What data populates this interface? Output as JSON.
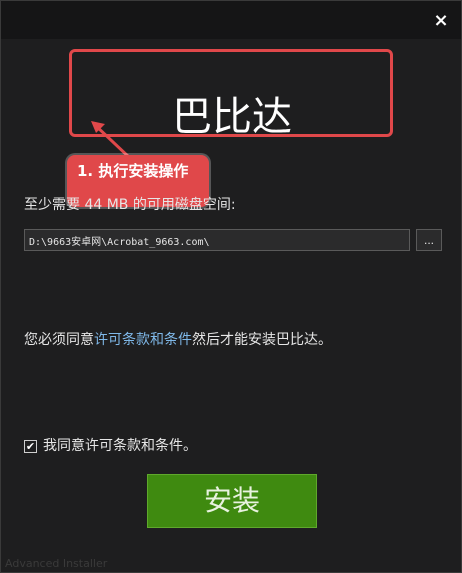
{
  "window": {
    "close_label": "×"
  },
  "header": {
    "app_title": "巴比达"
  },
  "annotation": {
    "callout_text": "1. 执行安装操作",
    "color": "#e0484a"
  },
  "install_location": {
    "space_label": "至少需要 44 MB 的可用磁盘空间:",
    "path_value": "D:\\9663安卓网\\Acrobat_9663.com\\",
    "browse_label": "..."
  },
  "license": {
    "text_before": "您必须同意",
    "link_text": "许可条款和条件",
    "text_after": "然后才能安装巴比达。",
    "link_color": "#7fb8e8"
  },
  "agreement": {
    "checked": true,
    "check_mark": "✔",
    "label": "我同意许可条款和条件。"
  },
  "actions": {
    "install_label": "安装",
    "install_color": "#3f8a10"
  },
  "footer": {
    "brand": "Advanced Installer"
  }
}
